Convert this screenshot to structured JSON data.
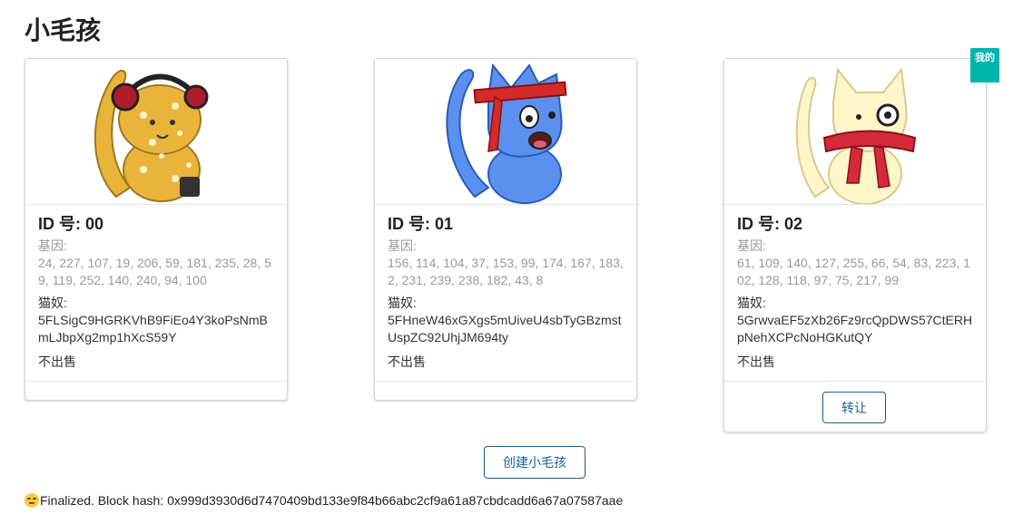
{
  "page": {
    "title": "小毛孩"
  },
  "kitties": [
    {
      "id_label": "ID 号: 00",
      "gene_label": "基因:",
      "gene_value": "24, 227, 107, 19, 206, 59, 181, 235, 28, 59, 119, 252, 140, 240, 94, 100",
      "owner_label": "猫奴:",
      "owner_value": "5FLSigC9HGRKVhB9FiEo4Y3koPsNmBmLJbpXg2mp1hXcS59Y",
      "sale_status": "不出售",
      "image": "yellow-spotted-cat-with-headphones",
      "mine": false
    },
    {
      "id_label": "ID 号: 01",
      "gene_label": "基因:",
      "gene_value": "156, 114, 104, 37, 153, 99, 174, 167, 183, 2, 231, 239, 238, 182, 43, 8",
      "owner_label": "猫奴:",
      "owner_value": "5FHneW46xGXgs5mUiveU4sbTyGBzmstUspZC92UhjJM694ty",
      "sale_status": "不出售",
      "image": "blue-cat-with-red-headband",
      "mine": false
    },
    {
      "id_label": "ID 号: 02",
      "gene_label": "基因:",
      "gene_value": "61, 109, 140, 127, 255, 66, 54, 83, 223, 102, 128, 118, 97, 75, 217, 99",
      "owner_label": "猫奴:",
      "owner_value": "5GrwvaEF5zXb26Fz9rcQpDWS57CtERHpNehXCPcNoHGKutQY",
      "sale_status": "不出售",
      "image": "cream-cat-with-monocle-and-scarf",
      "mine": true,
      "transfer_label": "转让"
    }
  ],
  "mine_badge": "我的",
  "create_button_label": "创建小毛孩",
  "status": {
    "icon": "smirk-emoji-icon",
    "text": "Finalized. Block hash: 0x999d3930d6d7470409bd133e9f84b66abc2cf9a61a87cbdcadd6a67a07587aae"
  },
  "colors": {
    "accent": "#1a5f94",
    "badge": "#00b5ad",
    "muted_text": "#999999"
  }
}
